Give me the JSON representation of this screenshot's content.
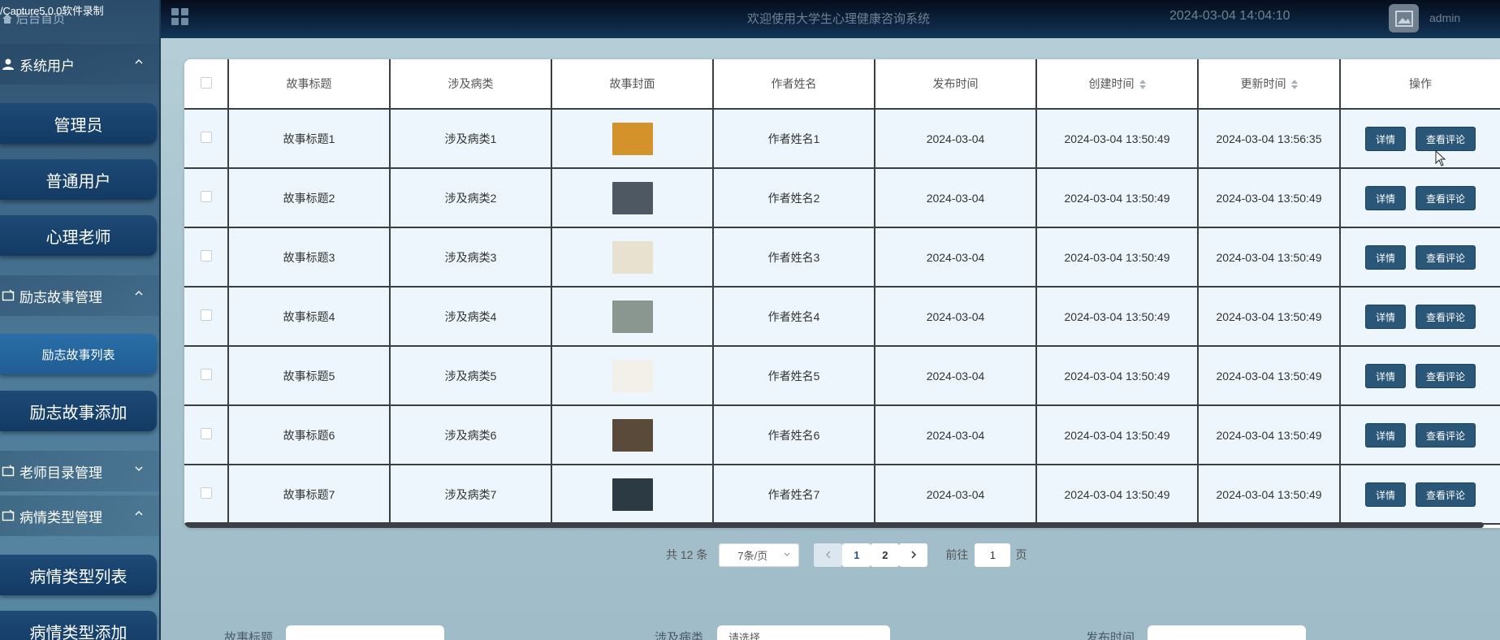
{
  "watermark": "/Capture5.0.0软件录制",
  "header": {
    "site_title": "欢迎使用大学生心理健康咨询系统",
    "datetime": "2024-03-04 14:04:10",
    "username": "admin"
  },
  "sidebar": {
    "home": "后台首页",
    "groups": [
      {
        "label": "系统用户"
      },
      {
        "label": "励志故事管理"
      },
      {
        "label": "老师目录管理"
      },
      {
        "label": "病情类型管理"
      }
    ],
    "items": [
      {
        "label": "管理员"
      },
      {
        "label": "普通用户"
      },
      {
        "label": "心理老师"
      },
      {
        "label": "励志故事列表"
      },
      {
        "label": "励志故事添加"
      },
      {
        "label": "病情类型列表"
      },
      {
        "label": "病情类型添加"
      }
    ]
  },
  "table": {
    "headers": [
      "故事标题",
      "涉及病类",
      "故事封面",
      "作者姓名",
      "发布时间",
      "创建时间",
      "更新时间",
      "操作"
    ],
    "rows": [
      {
        "title": "故事标题1",
        "category": "涉及病类1",
        "author": "作者姓名1",
        "published": "2024-03-04",
        "created": "2024-03-04 13:50:49",
        "updated": "2024-03-04 13:56:35",
        "cover_color": "#d4932a"
      },
      {
        "title": "故事标题2",
        "category": "涉及病类2",
        "author": "作者姓名2",
        "published": "2024-03-04",
        "created": "2024-03-04 13:50:49",
        "updated": "2024-03-04 13:50:49",
        "cover_color": "#4e5863"
      },
      {
        "title": "故事标题3",
        "category": "涉及病类3",
        "author": "作者姓名3",
        "published": "2024-03-04",
        "created": "2024-03-04 13:50:49",
        "updated": "2024-03-04 13:50:49",
        "cover_color": "#e8e1cf"
      },
      {
        "title": "故事标题4",
        "category": "涉及病类4",
        "author": "作者姓名4",
        "published": "2024-03-04",
        "created": "2024-03-04 13:50:49",
        "updated": "2024-03-04 13:50:49",
        "cover_color": "#8a9690"
      },
      {
        "title": "故事标题5",
        "category": "涉及病类5",
        "author": "作者姓名5",
        "published": "2024-03-04",
        "created": "2024-03-04 13:50:49",
        "updated": "2024-03-04 13:50:49",
        "cover_color": "#f3f0ea"
      },
      {
        "title": "故事标题6",
        "category": "涉及病类6",
        "author": "作者姓名6",
        "published": "2024-03-04",
        "created": "2024-03-04 13:50:49",
        "updated": "2024-03-04 13:50:49",
        "cover_color": "#5a4a3a"
      },
      {
        "title": "故事标题7",
        "category": "涉及病类7",
        "author": "作者姓名7",
        "published": "2024-03-04",
        "created": "2024-03-04 13:50:49",
        "updated": "2024-03-04 13:50:49",
        "cover_color": "#2c3a44"
      }
    ],
    "detail_label": "详情",
    "comment_label": "查看评论"
  },
  "pagination": {
    "total": "共 12 条",
    "page_size": "7条/页",
    "pages": [
      "1",
      "2"
    ],
    "goto_label": "前往",
    "goto_value": "1",
    "page_unit": "页"
  },
  "search_form": {
    "title_label": "故事标题",
    "category_label": "涉及病类",
    "category_placeholder": "请选择",
    "published_label": "发布时间"
  }
}
